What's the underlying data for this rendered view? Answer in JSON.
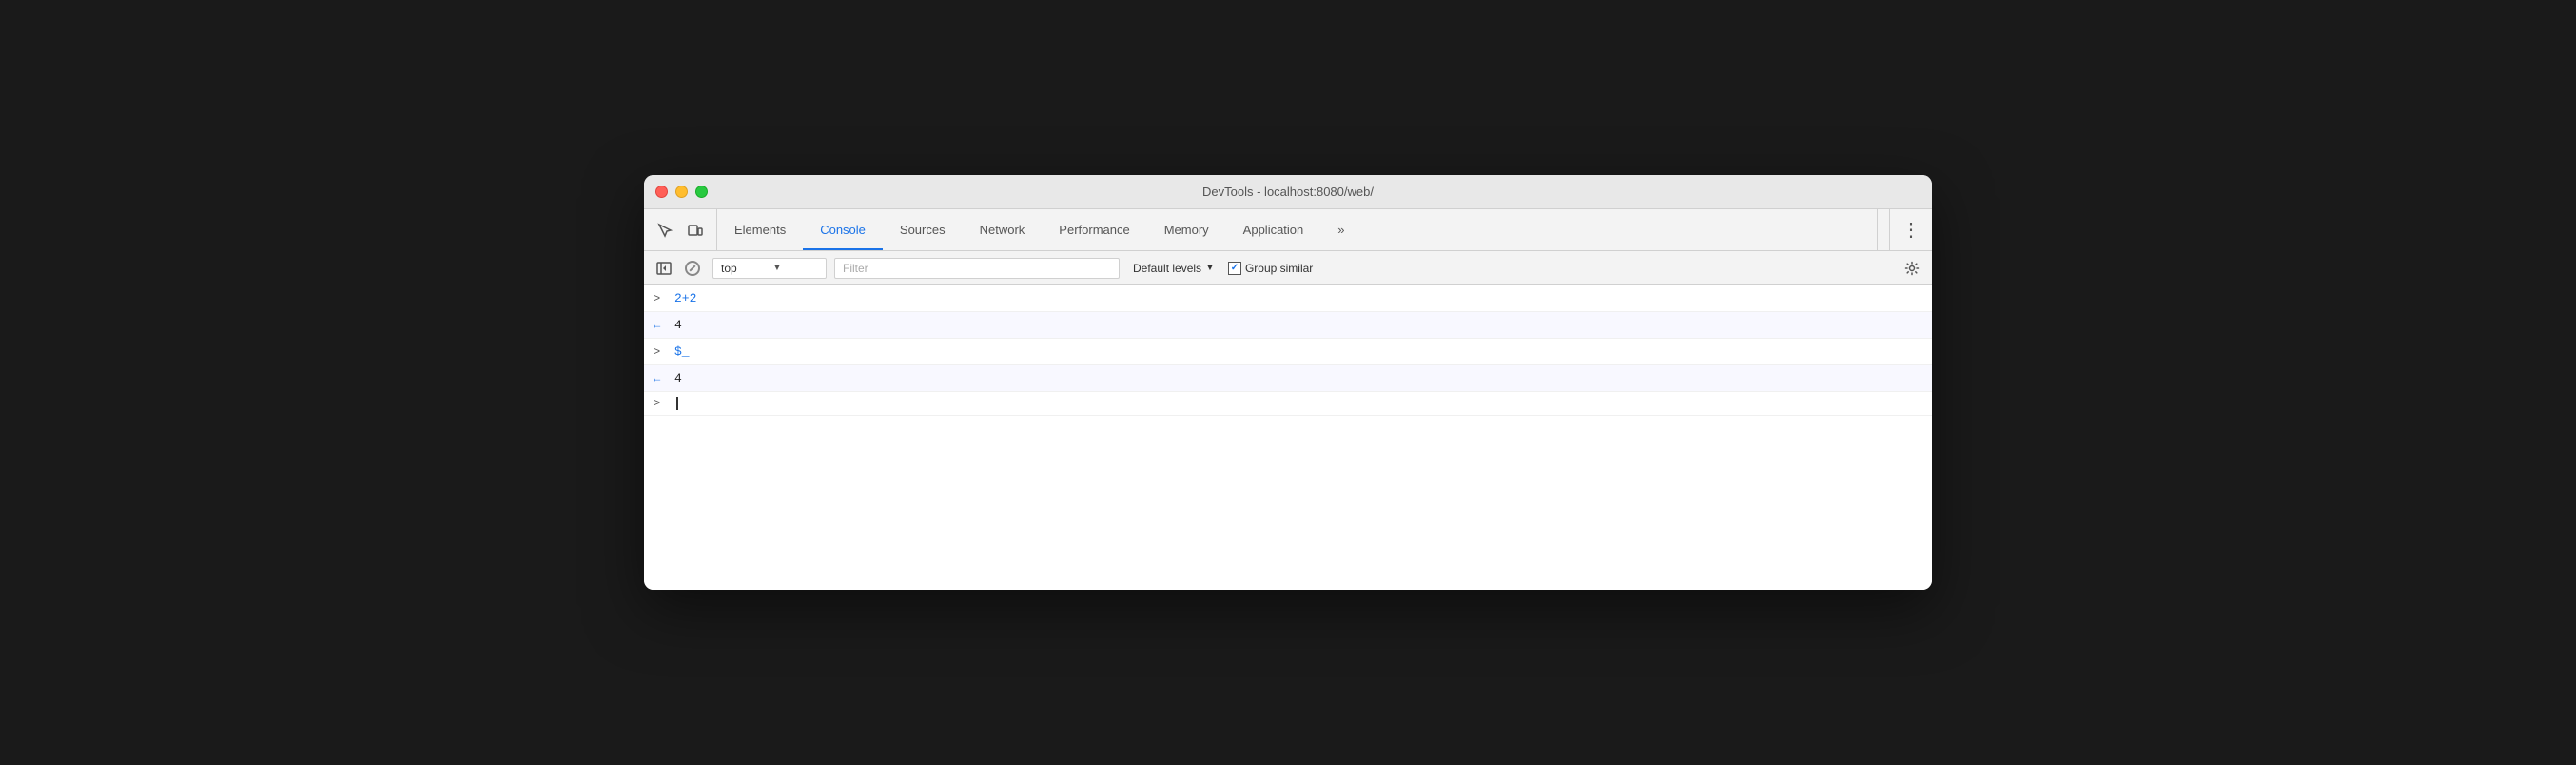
{
  "window": {
    "title": "DevTools - localhost:8080/web/"
  },
  "traffic_lights": {
    "close_label": "close",
    "minimize_label": "minimize",
    "maximize_label": "maximize"
  },
  "toolbar": {
    "inspect_icon": "cursor-icon",
    "device_icon": "device-icon",
    "tabs": [
      {
        "id": "elements",
        "label": "Elements",
        "active": false
      },
      {
        "id": "console",
        "label": "Console",
        "active": true
      },
      {
        "id": "sources",
        "label": "Sources",
        "active": false
      },
      {
        "id": "network",
        "label": "Network",
        "active": false
      },
      {
        "id": "performance",
        "label": "Performance",
        "active": false
      },
      {
        "id": "memory",
        "label": "Memory",
        "active": false
      },
      {
        "id": "application",
        "label": "Application",
        "active": false
      }
    ],
    "more_label": "»",
    "kebab_label": "⋮"
  },
  "console_toolbar": {
    "panel_icon": "panel-icon",
    "no_entry_icon": "no-entry-icon",
    "context_value": "top",
    "context_arrow": "▼",
    "filter_placeholder": "Filter",
    "levels_label": "Default levels",
    "levels_arrow": "▼",
    "group_similar_label": "Group similar",
    "group_similar_checked": true,
    "settings_icon": "gear-icon"
  },
  "console_entries": [
    {
      "id": 1,
      "type": "input",
      "arrow": ">",
      "text": "2+2"
    },
    {
      "id": 2,
      "type": "output",
      "arrow": "<",
      "text": "4"
    },
    {
      "id": 3,
      "type": "input",
      "arrow": ">",
      "text": "$_"
    },
    {
      "id": 4,
      "type": "output",
      "arrow": "<",
      "text": "4"
    }
  ],
  "console_prompt": {
    "arrow": ">",
    "cursor": "|"
  }
}
